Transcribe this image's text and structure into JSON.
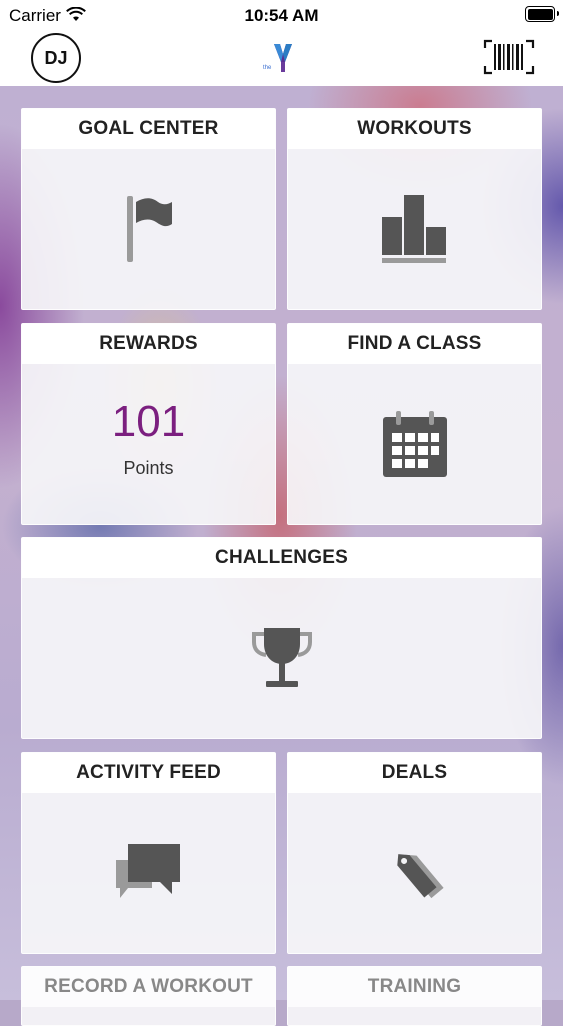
{
  "status_bar": {
    "carrier": "Carrier",
    "time": "10:54 AM"
  },
  "header": {
    "avatar_initials": "DJ",
    "logo_text": "the",
    "logo_color": "#3b6fd0",
    "barcode_icon": "barcode-scanner-icon"
  },
  "tiles": {
    "goal_center": {
      "title": "GOAL CENTER",
      "icon": "flag-icon"
    },
    "workouts": {
      "title": "WORKOUTS",
      "icon": "bar-chart-icon"
    },
    "rewards": {
      "title": "REWARDS",
      "points": "101",
      "points_label": "Points"
    },
    "find_a_class": {
      "title": "FIND A CLASS",
      "icon": "calendar-icon"
    },
    "challenges": {
      "title": "CHALLENGES",
      "icon": "trophy-icon"
    },
    "activity_feed": {
      "title": "ACTIVITY FEED",
      "icon": "chat-bubbles-icon"
    },
    "deals": {
      "title": "DEALS",
      "icon": "tag-icon"
    },
    "record_a_workout": {
      "title": "RECORD A WORKOUT"
    },
    "training": {
      "title": "TRAINING"
    }
  },
  "colors": {
    "accent_points": "#7b1f7f",
    "icon_gray": "#555555"
  }
}
